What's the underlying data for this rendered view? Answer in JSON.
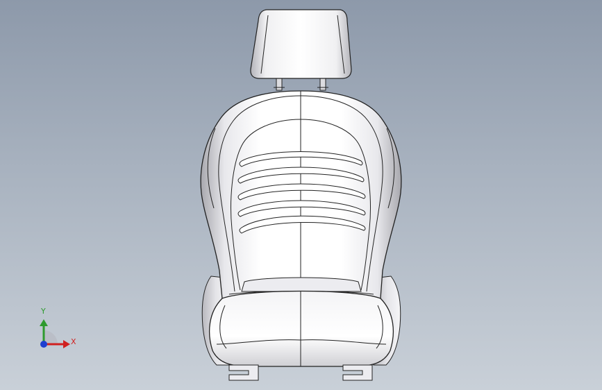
{
  "viewport": {
    "background_top": "#8d99aa",
    "background_bottom": "#c9d0d8"
  },
  "model": {
    "icon": "car-seat-model"
  },
  "triad": {
    "x_label": "X",
    "y_label": "Y",
    "x_color": "#d02020",
    "y_color": "#2e9a2e",
    "z_color": "#1f3fd0"
  }
}
